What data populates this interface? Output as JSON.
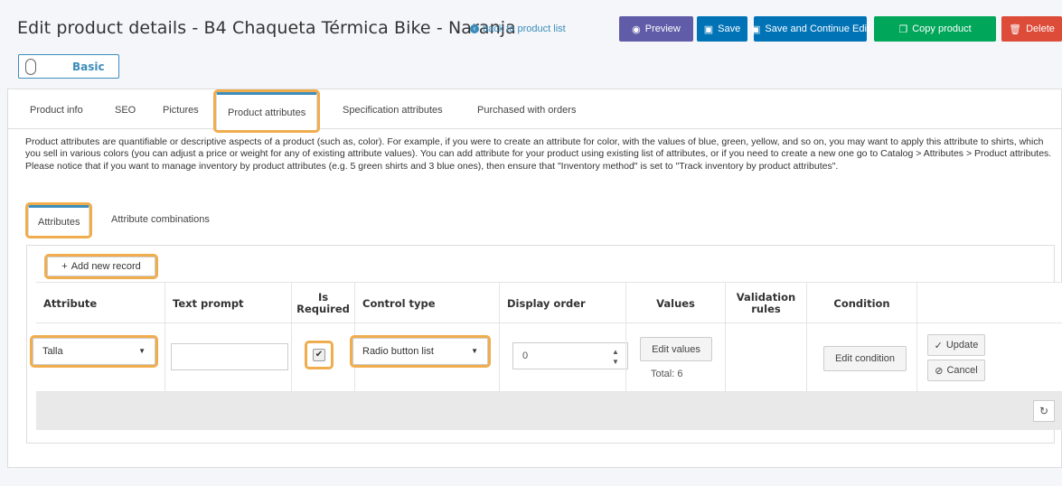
{
  "header": {
    "title": "Edit product details - B4 Chaqueta Térmica Bike - Naranja",
    "back_link": "back to product list",
    "buttons": {
      "preview": "Preview",
      "save": "Save",
      "save_continue": "Save and Continue Edit",
      "copy": "Copy product",
      "delete": "Delete"
    }
  },
  "mode_toggle": {
    "label": "Basic"
  },
  "tabs": [
    {
      "label": "Product info"
    },
    {
      "label": "SEO"
    },
    {
      "label": "Pictures"
    },
    {
      "label": "Product attributes"
    },
    {
      "label": "Specification attributes"
    },
    {
      "label": "Purchased with orders"
    }
  ],
  "description": "Product attributes are quantifiable or descriptive aspects of a product (such as, color). For example, if you were to create an attribute for color, with the values of blue, green, yellow, and so on, you may want to apply this attribute to shirts, which you sell in various colors (you can adjust a price or weight for any of existing attribute values). You can add attribute for your product using existing list of attributes, or if you need to create a new one go to Catalog > Attributes > Product attributes. Please notice that if you want to manage inventory by product attributes (e.g. 5 green shirts and 3 blue ones), then ensure that \"Inventory method\" is set to \"Track inventory by product attributes\".",
  "subtabs": [
    {
      "label": "Attributes"
    },
    {
      "label": "Attribute combinations"
    }
  ],
  "grid": {
    "add_label": "Add new record",
    "columns": {
      "attribute": "Attribute",
      "text_prompt": "Text prompt",
      "is_required": "Is Required",
      "control_type": "Control type",
      "display_order": "Display order",
      "values": "Values",
      "validation_rules": "Validation rules",
      "condition": "Condition"
    },
    "row": {
      "attribute": "Talla",
      "text_prompt": "",
      "is_required": true,
      "control_type": "Radio button list",
      "display_order": "0",
      "edit_values": "Edit values",
      "total": "Total: 6",
      "edit_condition": "Edit condition",
      "update": "Update",
      "cancel": "Cancel"
    }
  }
}
